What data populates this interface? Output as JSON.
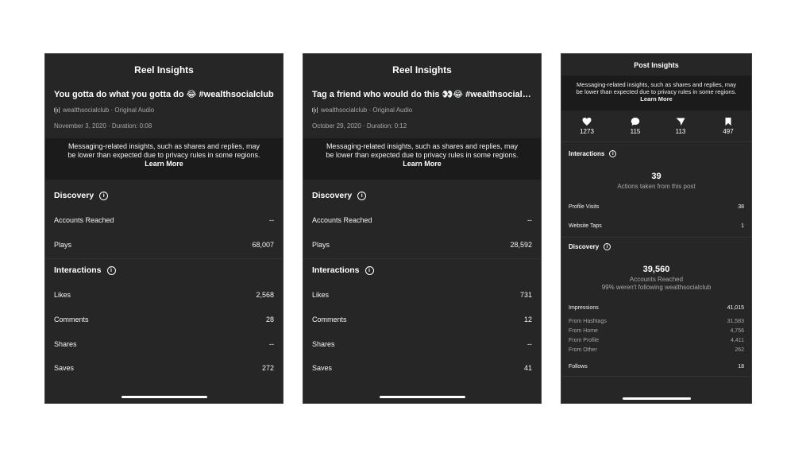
{
  "reel1": {
    "header": "Reel Insights",
    "title": "You gotta do what you gotta do 😂 #wealthsocialclub",
    "audio": "wealthsocialclub · Original Audio",
    "date": "November 3, 2020 · Duration: 0:08",
    "notice_text": "Messaging-related insights, such as shares and replies, may be lower than expected due to privacy rules in some regions.",
    "notice_link": "Learn More",
    "discovery_label": "Discovery",
    "discovery_rows": [
      {
        "label": "Accounts Reached",
        "value": "--"
      },
      {
        "label": "Plays",
        "value": "68,007"
      }
    ],
    "interactions_label": "Interactions",
    "interaction_rows": [
      {
        "label": "Likes",
        "value": "2,568"
      },
      {
        "label": "Comments",
        "value": "28"
      },
      {
        "label": "Shares",
        "value": "--"
      },
      {
        "label": "Saves",
        "value": "272"
      }
    ]
  },
  "reel2": {
    "header": "Reel Insights",
    "title": "Tag a friend who would do this 👀😂 #wealthsocialclub",
    "audio": "wealthsocialclub · Original Audio",
    "date": "October 29, 2020 · Duration: 0:12",
    "notice_text": "Messaging-related insights, such as shares and replies, may be lower than expected due to privacy rules in some regions.",
    "notice_link": "Learn More",
    "discovery_label": "Discovery",
    "discovery_rows": [
      {
        "label": "Accounts Reached",
        "value": "--"
      },
      {
        "label": "Plays",
        "value": "28,592"
      }
    ],
    "interactions_label": "Interactions",
    "interaction_rows": [
      {
        "label": "Likes",
        "value": "731"
      },
      {
        "label": "Comments",
        "value": "12"
      },
      {
        "label": "Shares",
        "value": "--"
      },
      {
        "label": "Saves",
        "value": "41"
      }
    ]
  },
  "post": {
    "header": "Post Insights",
    "notice_text": "Messaging-related insights, such as shares and replies, may be lower than expected due to privacy rules in some regions.",
    "notice_link": "Learn More",
    "stats": [
      {
        "icon": "heart-icon",
        "value": "1273"
      },
      {
        "icon": "comment-icon",
        "value": "115"
      },
      {
        "icon": "share-icon",
        "value": "113"
      },
      {
        "icon": "bookmark-icon",
        "value": "497"
      }
    ],
    "interactions_label": "Interactions",
    "interactions_total": "39",
    "interactions_caption": "Actions taken from this post",
    "interaction_rows": [
      {
        "label": "Profile Visits",
        "value": "38"
      },
      {
        "label": "Website Taps",
        "value": "1"
      }
    ],
    "discovery_label": "Discovery",
    "accounts_reached": "39,560",
    "accounts_reached_label": "Accounts Reached",
    "following_note": "99% weren't following wealthsocialclub",
    "impressions": {
      "label": "Impressions",
      "value": "41,015"
    },
    "impression_sources": [
      {
        "label": "From Hashtags",
        "value": "31,583"
      },
      {
        "label": "From Home",
        "value": "4,756"
      },
      {
        "label": "From Profile",
        "value": "4,411"
      },
      {
        "label": "From Other",
        "value": "262"
      }
    ],
    "follows": {
      "label": "Follows",
      "value": "18"
    }
  },
  "colors": {
    "panel_bg": "#262626",
    "notice_bg": "#1b1b1b",
    "muted_text": "#a8a8a8"
  }
}
